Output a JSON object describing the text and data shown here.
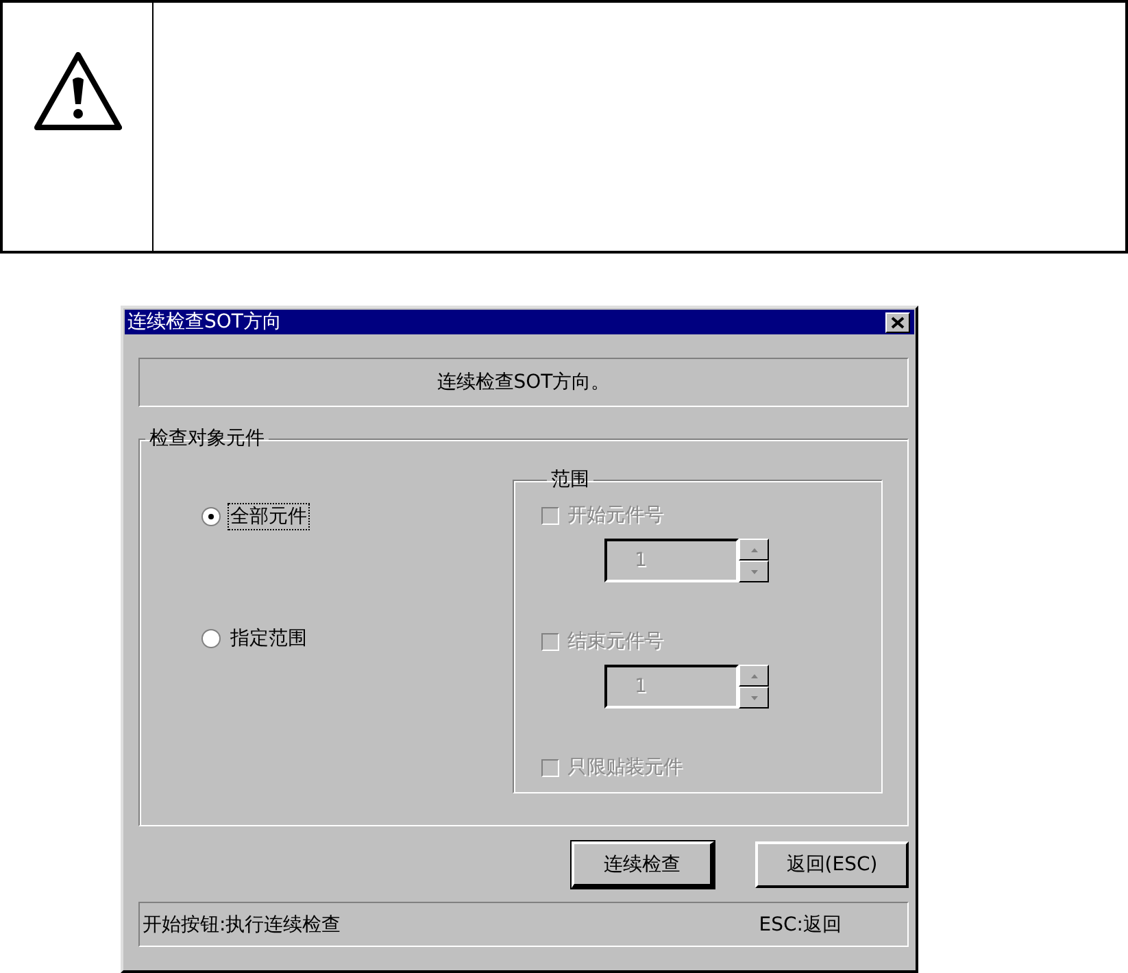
{
  "dialog": {
    "title": "连续检查SOT方向",
    "message": "连续检查SOT方向。",
    "target_group": {
      "title": "检查对象元件",
      "radios": [
        {
          "label": "全部元件",
          "selected": true,
          "focused": true
        },
        {
          "label": "指定范围",
          "selected": false,
          "focused": false
        }
      ]
    },
    "range_group": {
      "title": "范围",
      "items": [
        {
          "kind": "checkbox",
          "label": "开始元件号",
          "checked": false,
          "disabled": true
        },
        {
          "kind": "spinner",
          "value": "1",
          "disabled": true
        },
        {
          "kind": "checkbox",
          "label": "结束元件号",
          "checked": false,
          "disabled": true
        },
        {
          "kind": "spinner",
          "value": "1",
          "disabled": true
        },
        {
          "kind": "checkbox",
          "label": "只限贴装元件",
          "checked": false,
          "disabled": true
        }
      ]
    },
    "buttons": [
      {
        "label": "连续检查",
        "default": true
      },
      {
        "label": "返回(ESC)",
        "default": false
      }
    ],
    "status_bar": {
      "left": "开始按钮:执行连续检查",
      "right": "ESC:返回"
    }
  }
}
